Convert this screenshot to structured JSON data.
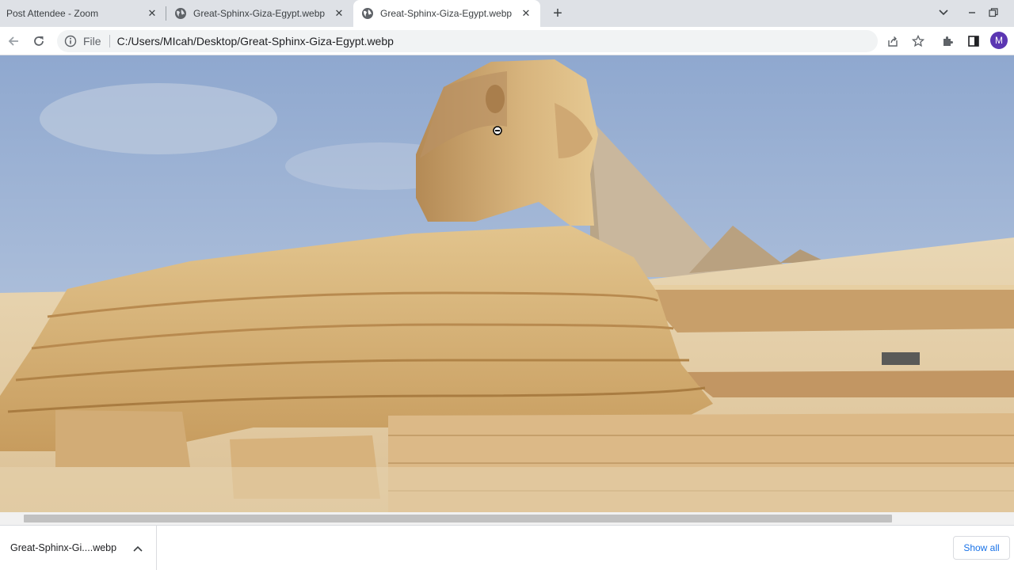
{
  "tabs": [
    {
      "title": "Post Attendee - Zoom",
      "active": false
    },
    {
      "title": "Great-Sphinx-Giza-Egypt.webp (",
      "active": false
    },
    {
      "title": "Great-Sphinx-Giza-Egypt.webp (",
      "active": true
    }
  ],
  "address_bar": {
    "scheme_label": "File",
    "url": "C:/Users/MIcah/Desktop/Great-Sphinx-Giza-Egypt.webp"
  },
  "profile": {
    "initial": "M",
    "color": "#5b36b2"
  },
  "download_bar": {
    "item_name": "Great-Sphinx-Gi....webp",
    "show_all_label": "Show all"
  },
  "icons": {
    "tab_favicon": "globe-icon",
    "back": "arrow-left-icon",
    "reload": "reload-icon",
    "site_info": "info-icon",
    "share": "share-icon",
    "bookmark": "star-icon",
    "extensions": "puzzle-icon",
    "side_panel": "side-panel-icon"
  },
  "colors": {
    "accent": "#1a73e8",
    "tabstrip": "#dee1e6"
  }
}
